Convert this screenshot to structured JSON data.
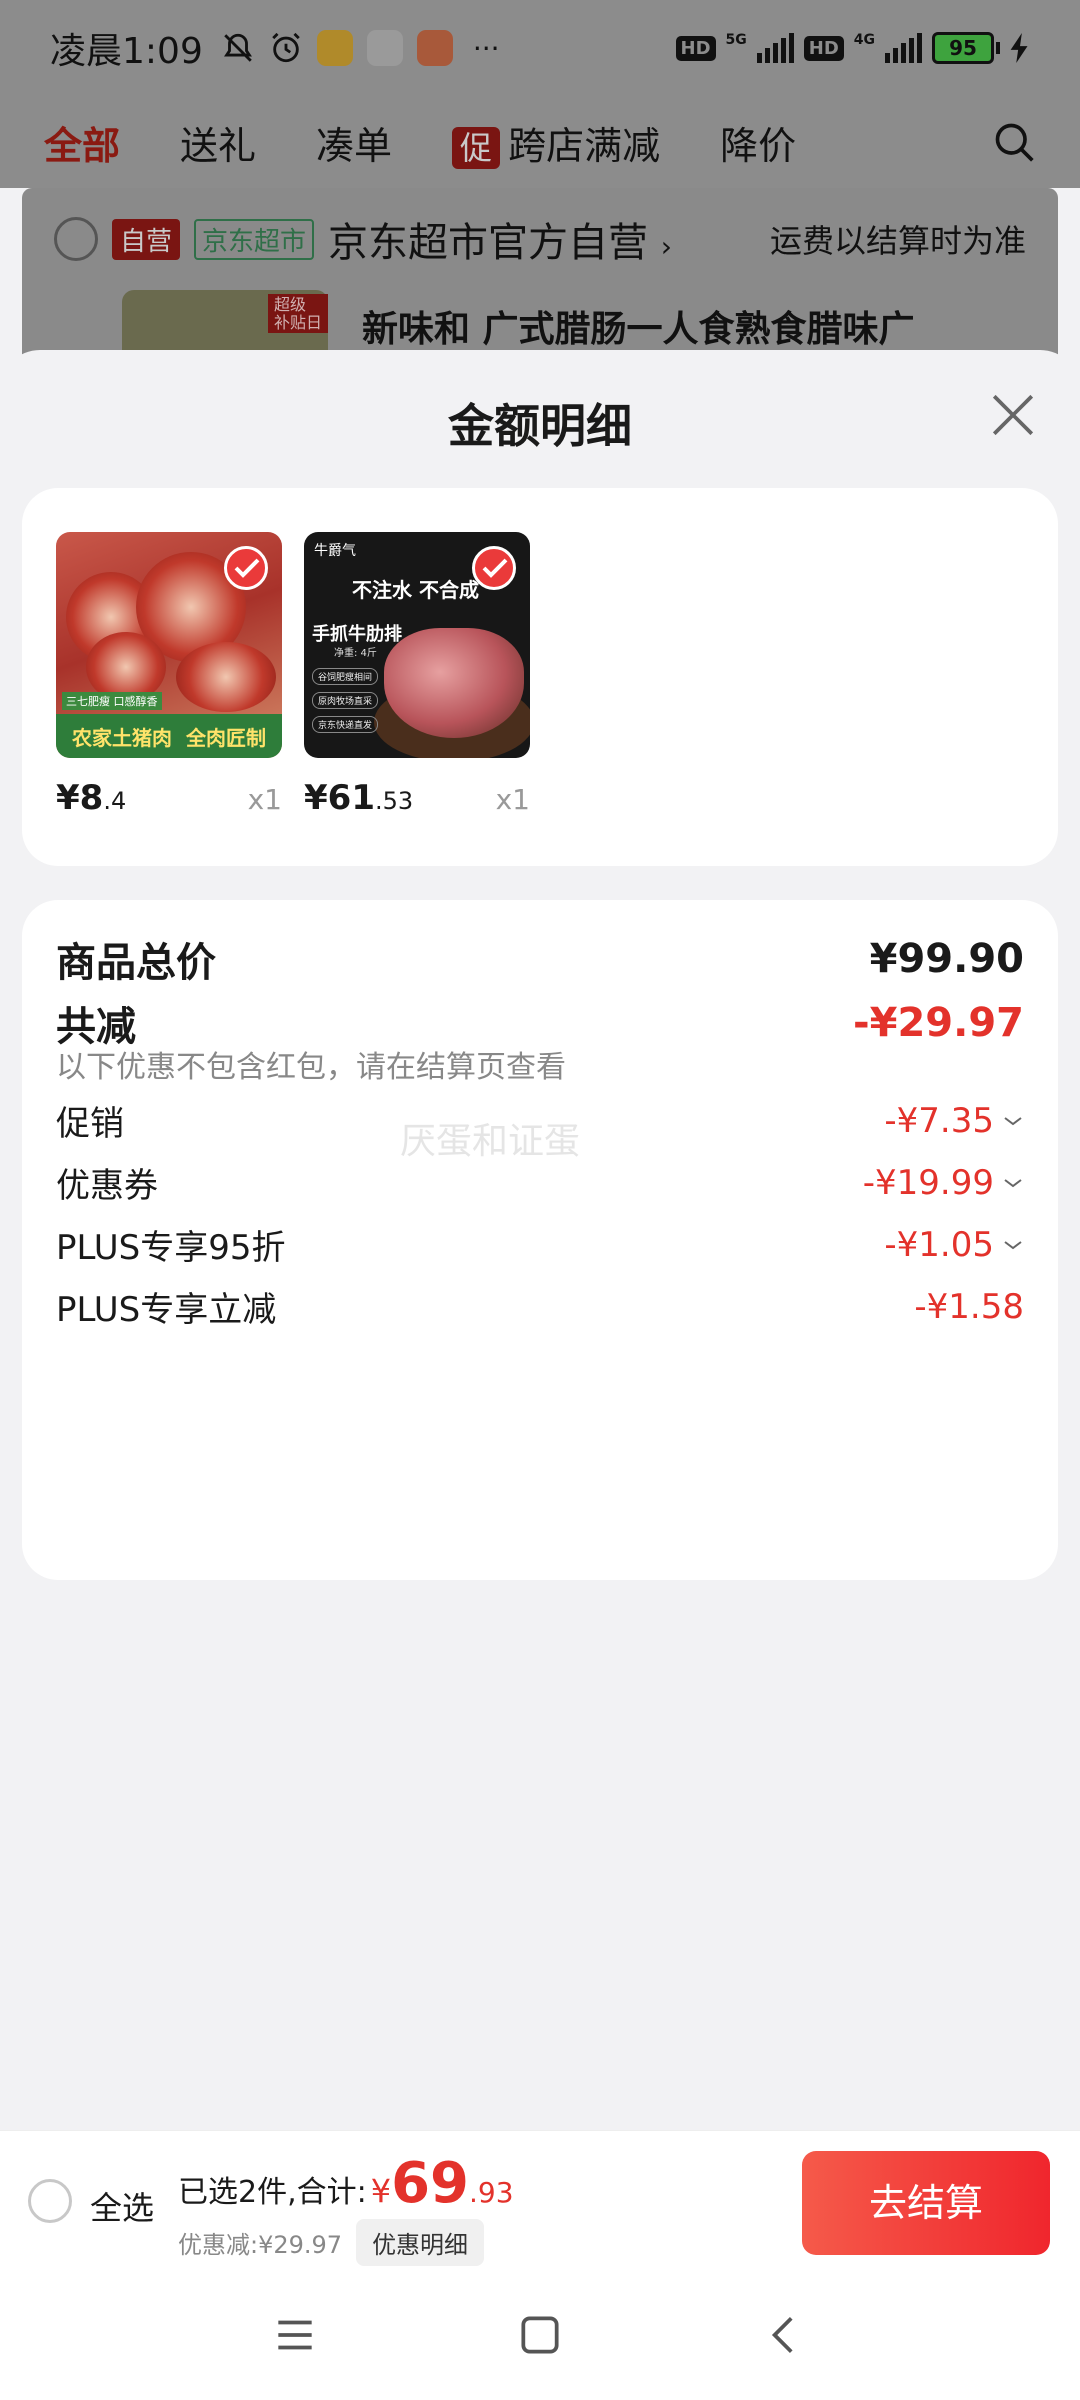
{
  "status_bar": {
    "time": "凌晨1:09",
    "more": "···",
    "net1": "5G",
    "net2": "4G",
    "hd": "HD",
    "battery": "95"
  },
  "top_nav": {
    "tabs": [
      "全部",
      "送礼",
      "凑单"
    ],
    "promo_tag": "促",
    "promo_label": "跨店满减",
    "tab_last": "降价"
  },
  "store": {
    "tag_self": "自营",
    "tag_market": "京东超市",
    "name": "京东超市官方自营",
    "chevron": "›",
    "shipping_note": "运费以结算时为准",
    "thumb_badge": "超级\n补贴日",
    "product_title": "新味和 广式腊肠一人食熟食腊味广"
  },
  "sheet": {
    "title": "金额明细",
    "products": [
      {
        "price_int": "¥8",
        "price_dec": ".4",
        "qty": "x1",
        "img_sub": "三七肥瘦 口感醇香",
        "img_band": [
          "农家土猪肉",
          "全肉匠制"
        ]
      },
      {
        "price_int": "¥61",
        "price_dec": ".53",
        "qty": "x1",
        "img_brand": "牛爵气",
        "img_slogan": "不注水  不合成",
        "img_name": "手抓牛肋排",
        "img_weight": "净重: 4斤",
        "img_features": [
          "谷饲肥瘦相间",
          "原肉牧场直采",
          "京东快递直发"
        ]
      }
    ],
    "summary": {
      "total_label": "商品总价",
      "total_value": "¥99.90",
      "reduce_label": "共减",
      "reduce_value": "-¥29.97",
      "note": "以下优惠不包含红包，请在结算页查看",
      "items": [
        {
          "label": "促销",
          "value": "-¥7.35",
          "expandable": true
        },
        {
          "label": "优惠券",
          "value": "-¥19.99",
          "expandable": true
        },
        {
          "label": "PLUS专享95折",
          "value": "-¥1.05",
          "expandable": true
        },
        {
          "label": "PLUS专享立减",
          "value": "-¥1.58",
          "expandable": false
        }
      ]
    },
    "watermark": "厌蛋和证蛋"
  },
  "bottom_bar": {
    "select_all": "全选",
    "selected_text": "已选2件,合计:",
    "currency": "¥",
    "amount_int": "69",
    "amount_dec": ".93",
    "discount_text": "优惠减:¥29.97",
    "detail_button": "优惠明细",
    "checkout_button": "去结算"
  },
  "colors": {
    "accent": "#e3322b",
    "checkout_gradient_start": "#f55a4a",
    "checkout_gradient_end": "#f0262d"
  },
  "icons": {
    "close": "close-icon",
    "search": "search-icon",
    "check": "check-icon",
    "chevron": "chevron-down-icon",
    "nav_menu": "menu-icon",
    "nav_home": "home-icon",
    "nav_back": "back-icon"
  }
}
